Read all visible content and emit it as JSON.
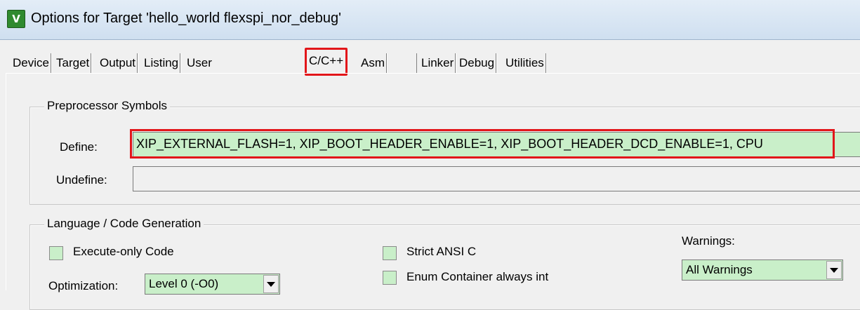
{
  "window": {
    "icon_glyph": "V",
    "title": "Options for Target 'hello_world flexspi_nor_debug'"
  },
  "tabs": [
    {
      "label": "Device"
    },
    {
      "label": "Target"
    },
    {
      "label": "Output"
    },
    {
      "label": "Listing"
    },
    {
      "label": "User"
    },
    {
      "label": "C/C++",
      "selected": true
    },
    {
      "label": "Asm"
    },
    {
      "label": "Linker"
    },
    {
      "label": "Debug"
    },
    {
      "label": "Utilities"
    }
  ],
  "preprocessor": {
    "group_label": "Preprocessor Symbols",
    "define_label": "Define:",
    "define_value": "XIP_EXTERNAL_FLASH=1, XIP_BOOT_HEADER_ENABLE=1, XIP_BOOT_HEADER_DCD_ENABLE=1, CPU",
    "undefine_label": "Undefine:",
    "undefine_value": ""
  },
  "language": {
    "group_label": "Language / Code Generation",
    "execute_only_label": "Execute-only Code",
    "optimization_label": "Optimization:",
    "optimization_value": "Level 0 (-O0)",
    "strict_ansi_label": "Strict ANSI C",
    "enum_container_label": "Enum Container always int",
    "warnings_label": "Warnings:",
    "warnings_value": "All Warnings"
  },
  "colors": {
    "highlight_red": "#e2161a",
    "field_green": "#c9efc9"
  },
  "icons": [
    "app-icon",
    "dropdown-arrow-icon"
  ]
}
